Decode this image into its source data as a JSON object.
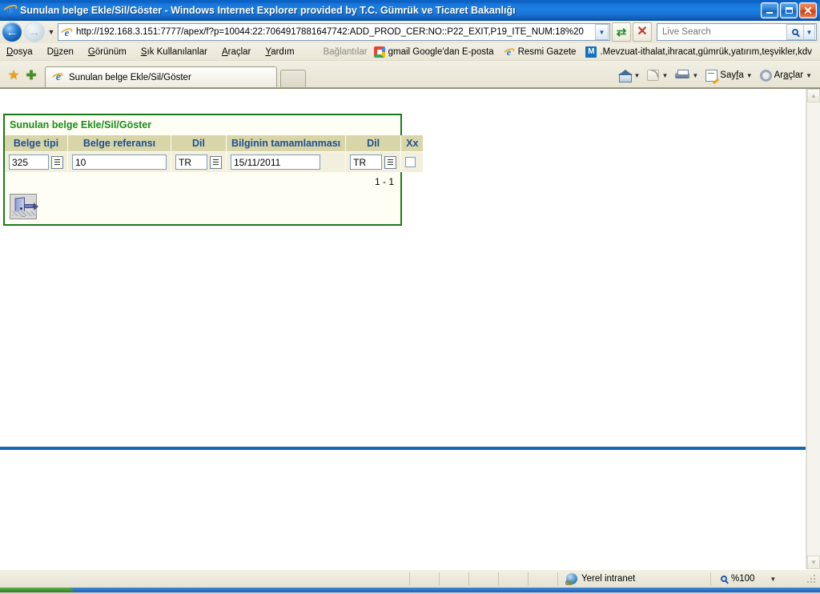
{
  "window": {
    "title": "Sunulan belge Ekle/Sil/Göster - Windows Internet Explorer provided by T.C. Gümrük ve Ticaret Bakanlığı",
    "icon": "ie-icon",
    "minimize_label": "",
    "maximize_label": "",
    "close_label": "✕"
  },
  "nav": {
    "back_label": "←",
    "forward_label": "→",
    "recent_caret": "▼",
    "refresh_label": "↻",
    "stop_label": "✕"
  },
  "address": {
    "url": "http://192.168.3.151:7777/apex/f?p=10044:22:7064917881647742:ADD_PROD_CER:NO::P22_EXIT,P19_ITE_NUM:18%20",
    "dropdown_caret": "▼",
    "favicon": "ie-icon"
  },
  "search": {
    "placeholder": "Live Search",
    "value": "",
    "go_icon": "magnifier-icon",
    "caret": "▼"
  },
  "menubar": {
    "items": [
      {
        "pre": "",
        "key": "D",
        "post": "osya"
      },
      {
        "pre": "D",
        "key": "ü",
        "post": "zen"
      },
      {
        "pre": "",
        "key": "G",
        "post": "örünüm"
      },
      {
        "pre": "",
        "key": "S",
        "post": "ık Kullanılanlar"
      },
      {
        "pre": "",
        "key": "A",
        "post": "raçlar"
      },
      {
        "pre": "",
        "key": "Y",
        "post": "ardım"
      }
    ],
    "links_label": "Bağlantılar",
    "links": [
      {
        "icon": "google-icon",
        "label": "gmail Google'dan E-posta"
      },
      {
        "icon": "ie-icon",
        "label": "Resmi Gazete"
      },
      {
        "icon": "m-icon",
        "label": ".Mevzuat-ithalat,ihracat,gümrük,yatırım,teşvikler,kdv"
      }
    ],
    "overflow": "»"
  },
  "tabbar": {
    "favorites_star": "★",
    "add_favorite": "★",
    "tab_label": "Sunulan belge Ekle/Sil/Göster",
    "tab_icon": "ie-icon",
    "new_tab_label": "",
    "commands": [
      {
        "icon": "home-icon",
        "label": "",
        "caret": "▼"
      },
      {
        "icon": "rss-icon",
        "label": "",
        "caret": "▼"
      },
      {
        "icon": "print-icon",
        "label": "",
        "caret": "▼"
      },
      {
        "icon": "page-icon",
        "label": "Sayfa",
        "caret": "▼"
      },
      {
        "icon": "gear-icon",
        "label": "Araçlar",
        "caret": "▼"
      }
    ],
    "overflow": "»"
  },
  "page": {
    "region_title": "Sunulan belge Ekle/Sil/Göster",
    "columns": [
      "Belge tipi",
      "Belge referansı",
      "Dil",
      "Bilginin tamamlanması",
      "Dil",
      "Xx"
    ],
    "rows": [
      {
        "belge_tipi": "325",
        "belge_referansi": "10",
        "dil1": "TR",
        "bilginin_tamamlanmasi": "15/11/2011",
        "dil2": "TR",
        "xx_checked": false
      }
    ],
    "pagination": "1 - 1",
    "exit_button": "exit-door-icon",
    "colors": {
      "region_border": "#1a7a1a",
      "region_title": "#1a8c1a",
      "header_bg": "#d8d5a8",
      "header_text": "#1f4f8f",
      "row_bg": "#f2f0dc",
      "rule": "#1469b0"
    }
  },
  "scrollbar": {
    "up_arrow": "▲",
    "down_arrow": "▼"
  },
  "status": {
    "message": "",
    "zone_icon": "globe-icon",
    "zone": "Yerel intranet",
    "zoom_icon": "magnifier-icon",
    "zoom": "%100",
    "zoom_caret": "▼"
  }
}
